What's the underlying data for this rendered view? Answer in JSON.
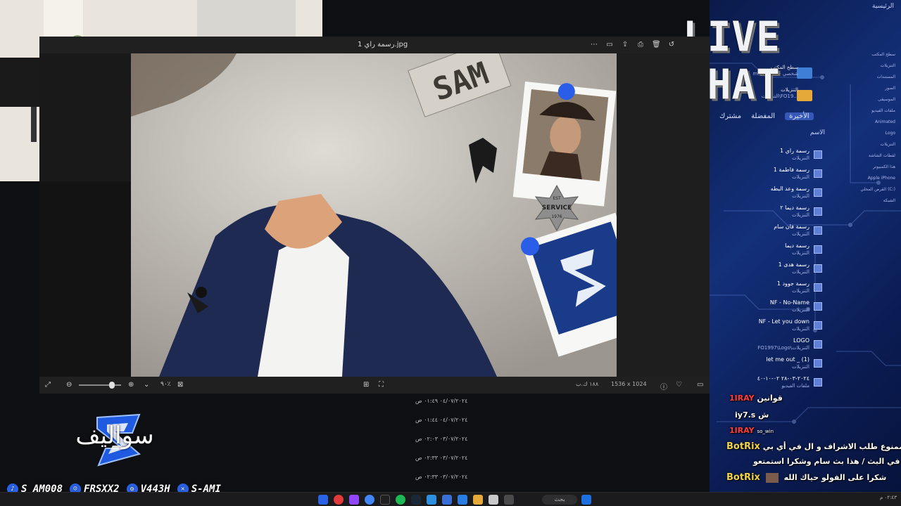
{
  "stream": {
    "live_chat_label": "LIVE CHAT",
    "socials": [
      {
        "icon": "tiktok-icon",
        "handle": "S_AM008"
      },
      {
        "icon": "snapchat-icon",
        "handle": "FRSXX2"
      },
      {
        "icon": "instagram-icon",
        "handle": "V443H"
      },
      {
        "icon": "x-twitter-icon",
        "handle": "S-AMI"
      }
    ],
    "brand_text": "سواليف"
  },
  "viewer": {
    "title": "رسمة راي 1.jpg",
    "zoom_level": "٩٠٪",
    "zoom_fraction": 0.82,
    "image_dimensions": "1536 x 1024",
    "file_size": "١٨٨ ك.ب",
    "photo_text": {
      "sam_sign": "SAM",
      "badge_est": "EST",
      "badge_text": "SERVICE",
      "badge_year": "1976"
    }
  },
  "file_dates": [
    "٠٤/٠٧/٢٠٢٤ ٠١:٤٩ ص",
    "٠٤/٠٧/٢٠٢٤ ٠١:٤٤ ص",
    "٠٣/٠٧/٢٠٢٤ ٠٢:٠٣ ص",
    "٠٣/٠٧/٢٠٢٤ ٠٢:٣٣ ص",
    "٠٣/٠٧/٢٠٢٤ ٠٢:٣٣ ص"
  ],
  "explorer": {
    "home_label": "الرئيسية",
    "tabs": [
      "مشترك",
      "المفضلة",
      "الأخيرة"
    ],
    "column_header": "الاسم",
    "pinned": [
      {
        "name": "سطح المكتب",
        "sub": "mohamed - شخصي"
      },
      {
        "name": "التنزيلات",
        "sub": "التنزيلات\\FO19..."
      }
    ],
    "files": [
      {
        "name": "رسمة راي 1",
        "sub": "التنزيلات"
      },
      {
        "name": "رسمة فاطمة 1",
        "sub": "التنزيلات"
      },
      {
        "name": "رسمة وعد البطه",
        "sub": "التنزيلات"
      },
      {
        "name": "رسمة ديما ٢",
        "sub": "التنزيلات"
      },
      {
        "name": "رسمة فان سام",
        "sub": "التنزيلات"
      },
      {
        "name": "رسمة ديما",
        "sub": "التنزيلات"
      },
      {
        "name": "رسمة هدى 1",
        "sub": "التنزيلات"
      },
      {
        "name": "رسمة جوود 1",
        "sub": "التنزيلات"
      },
      {
        "name": "NF - No-Name",
        "sub": "التنزيلات"
      },
      {
        "name": "NF - Let you down",
        "sub": "التنزيلات"
      },
      {
        "name": "LOGO",
        "sub": "FO1997\\Logo\\التنزيلات"
      },
      {
        "name": "let me out _ (1)",
        "sub": "التنزيلات"
      },
      {
        "name": "٢٠٢٤-٠٣-٢٨ ٠٢-١٠-٤٠",
        "sub": "ملفات الفيديو"
      }
    ],
    "side_items": [
      "سطح المكتب",
      "التنزيلات",
      "المستندات",
      "الصور",
      "الموسيقى",
      "ملفات الفيديو",
      "Animated",
      "Logo",
      "التنزيلات",
      "لقطات الشاشة",
      "هذا الكمبيوتر",
      "Apple iPhone",
      "القرص المحلي (C:)",
      "الشبكة"
    ]
  },
  "chat": {
    "messages": [
      {
        "user": "1IRAY",
        "text": "قوانين"
      },
      {
        "user": "iy7.s",
        "text": "ش"
      },
      {
        "user": "1IRAY",
        "text": "so_win"
      }
    ],
    "bot_messages": [
      {
        "bot": "BotRix",
        "text": "بة .ممنوع طلب الاشراف و ال في أي بي"
      },
      {
        "bot": "",
        "text": "ثاني في البث / هذا بث سام وشكرا استمتعو"
      },
      {
        "bot": "BotRix",
        "text": "شكرا على الفولو حياك الله"
      }
    ]
  },
  "taskbar": {
    "search_label": "بحث",
    "clock": "٠٢:٤٣ م"
  },
  "colors": {
    "accent_blue": "#1f5ae0",
    "bot_gold": "#f0d24a",
    "chat_red": "#ff3b3b",
    "viewer_bg": "#1c1c1c"
  }
}
